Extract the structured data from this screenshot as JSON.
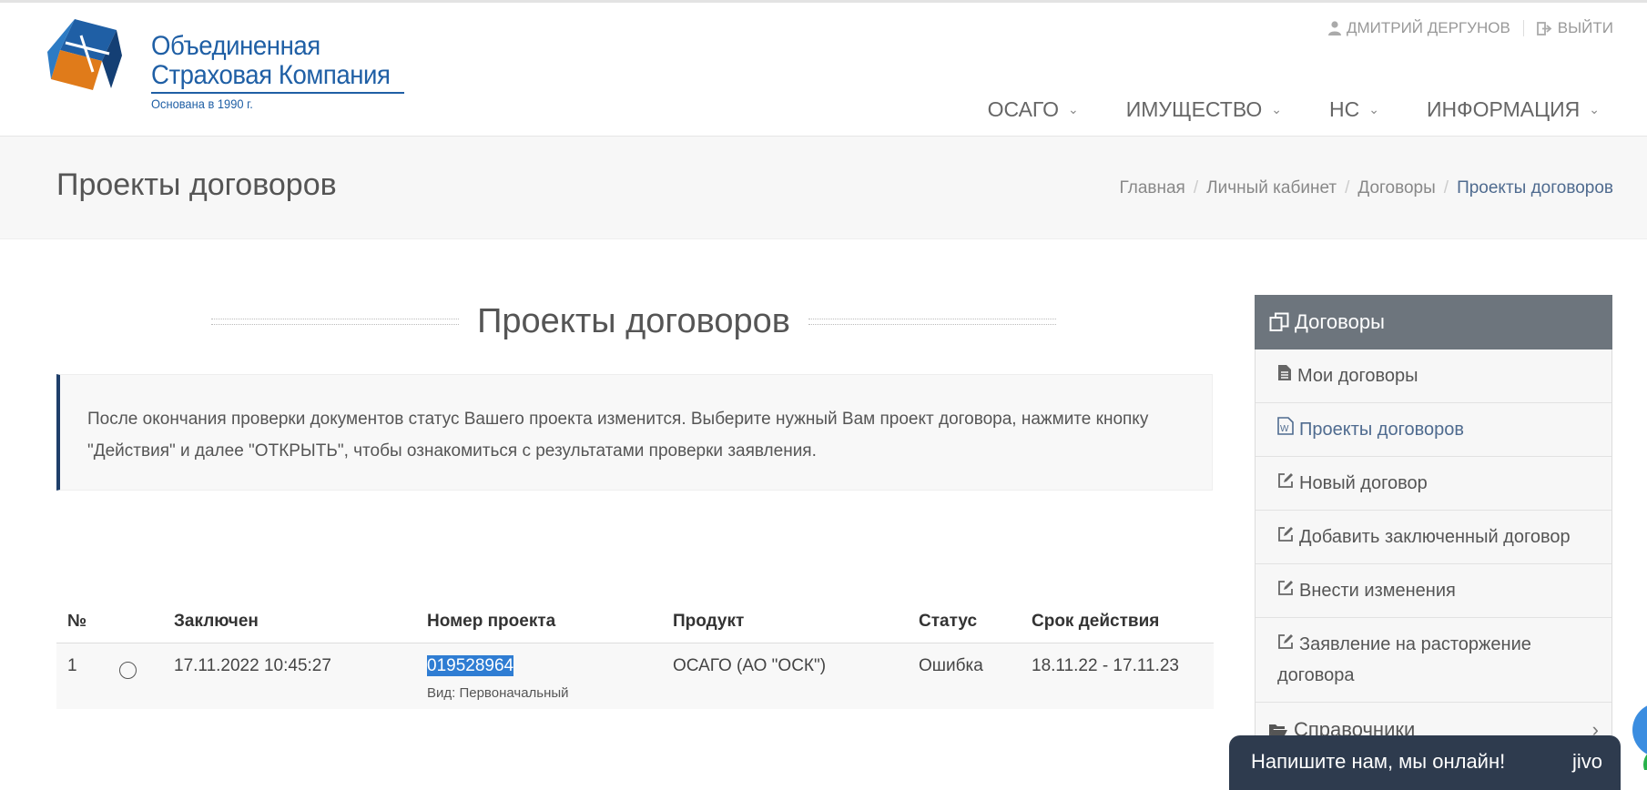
{
  "header": {
    "logo": {
      "line1": "Объединенная",
      "line2": "Страховая Компания",
      "line3": "Основана в 1990 г."
    },
    "user_name": "ДМИТРИЙ ДЕРГУНОВ",
    "logout_label": "ВЫЙТИ",
    "nav": [
      {
        "label": "ОСАГО"
      },
      {
        "label": "ИМУЩЕСТВО"
      },
      {
        "label": "НС"
      },
      {
        "label": "ИНФОРМАЦИЯ"
      }
    ]
  },
  "page": {
    "title": "Проекты договоров",
    "breadcrumb": [
      "Главная",
      "Личный кабинет",
      "Договоры",
      "Проекты договоров"
    ]
  },
  "section": {
    "heading": "Проекты договоров",
    "notice": "После окончания проверки документов статус Вашего проекта изменится. Выберите нужный Вам проект договора, нажмите кнопку \"Действия\" и далее \"ОТКРЫТЬ\", чтобы ознакомиться с результатами проверки заявления."
  },
  "table": {
    "columns": [
      "№",
      "",
      "Заключен",
      "Номер проекта",
      "Продукт",
      "Статус",
      "Срок действия"
    ],
    "rows": [
      {
        "num": "1",
        "concluded": "17.11.2022 10:45:27",
        "project_number": "019528964",
        "kind": "Вид: Первоначальный",
        "product": "ОСАГО (АО \"ОСК\")",
        "status": "Ошибка",
        "validity": "18.11.22 - 17.11.23"
      }
    ]
  },
  "sidebar": {
    "title": "Договоры",
    "items": [
      {
        "label": "Мои договоры",
        "icon": "file-icon"
      },
      {
        "label": "Проекты договоров",
        "icon": "word-file-icon"
      },
      {
        "label": "Новый договор",
        "icon": "edit-icon"
      },
      {
        "label": "Добавить заключенный договор",
        "icon": "edit-icon"
      },
      {
        "label": "Внести изменения",
        "icon": "edit-icon"
      },
      {
        "label": "Заявление на расторжение договора",
        "icon": "edit-icon"
      }
    ],
    "section2": "Справочники"
  },
  "chat": {
    "text": "Напишите нам, мы онлайн!",
    "brand": "jivo"
  },
  "colors": {
    "brand_blue": "#1f5fa5",
    "logo_orange": "#e07b1a",
    "sidebar_header": "#6d757d",
    "selection": "#2f7dd3",
    "chat_bg": "#2e3b4e"
  }
}
